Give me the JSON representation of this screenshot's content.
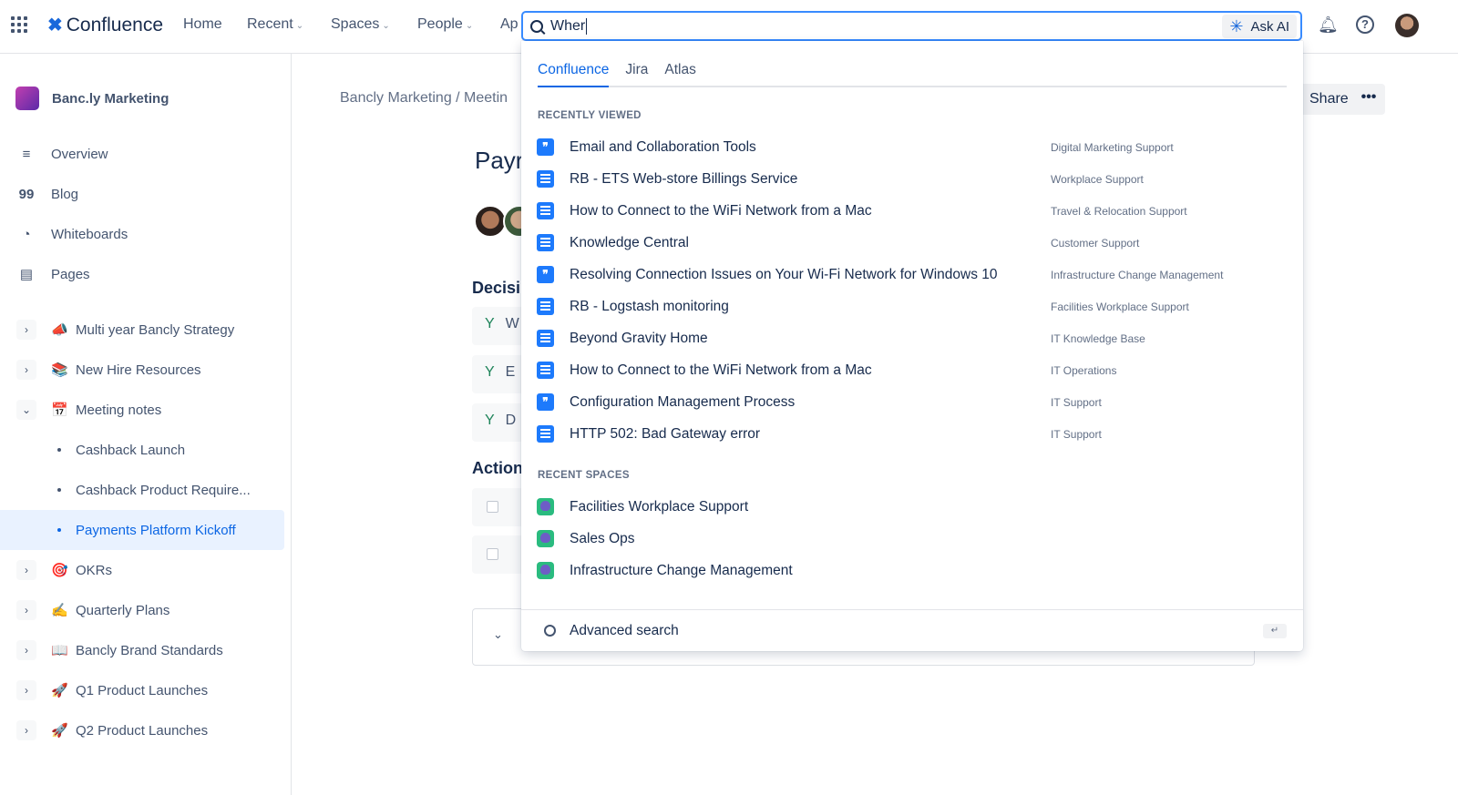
{
  "topbar": {
    "app_name": "Confluence",
    "nav": [
      "Home",
      "Recent",
      "Spaces",
      "People",
      "Ap"
    ],
    "search_value": "Wher",
    "ask_ai": "Ask AI"
  },
  "sidebar": {
    "space_name": "Banc.ly Marketing",
    "items": [
      {
        "label": "Overview",
        "icon": "≡"
      },
      {
        "label": "Blog",
        "icon": "99"
      },
      {
        "label": "Whiteboards",
        "icon": "◔"
      },
      {
        "label": "Pages",
        "icon": "▤"
      }
    ],
    "tree": [
      {
        "label": "Multi year Bancly Strategy",
        "emoji": "📣",
        "expand": "›"
      },
      {
        "label": "New Hire Resources",
        "emoji": "📚",
        "expand": "›"
      },
      {
        "label": "Meeting notes",
        "emoji": "📅",
        "expand": "⌄"
      },
      {
        "label": "Cashback Launch",
        "child": true
      },
      {
        "label": "Cashback Product Require...",
        "child": true
      },
      {
        "label": "Payments Platform Kickoff",
        "child": true,
        "selected": true
      },
      {
        "label": "OKRs",
        "emoji": "🎯",
        "expand": "›"
      },
      {
        "label": "Quarterly Plans",
        "emoji": "✍️",
        "expand": "›"
      },
      {
        "label": "Bancly Brand Standards",
        "emoji": "📖",
        "expand": "›"
      },
      {
        "label": "Q1 Product Launches",
        "emoji": "🚀",
        "expand": "›"
      },
      {
        "label": "Q2 Product Launches",
        "emoji": "🚀",
        "expand": "›"
      }
    ]
  },
  "main": {
    "breadcrumb": "Bancly Marketing  /  Meetin",
    "share": "Share",
    "more": "•••",
    "title": "Payr",
    "decisions_heading": "Decisi",
    "decisions": [
      "W",
      "E",
      "D"
    ],
    "actions_heading": "Action"
  },
  "search_dropdown": {
    "tabs": [
      "Confluence",
      "Jira",
      "Atlas"
    ],
    "recently_viewed_label": "RECENTLY VIEWED",
    "recent": [
      {
        "title": "Email and Collaboration Tools",
        "space": "Digital Marketing Support",
        "type": "blog"
      },
      {
        "title": "RB - ETS Web-store Billings Service",
        "space": "Workplace Support",
        "type": "page"
      },
      {
        "title": "How to Connect to the WiFi Network from a Mac",
        "space": "Travel & Relocation Support",
        "type": "page"
      },
      {
        "title": "Knowledge Central",
        "space": "Customer Support",
        "type": "page"
      },
      {
        "title": "Resolving Connection Issues on Your Wi-Fi Network for Windows 10",
        "space": "Infrastructure Change Management",
        "type": "blog"
      },
      {
        "title": "RB - Logstash monitoring",
        "space": "Facilities Workplace Support",
        "type": "page"
      },
      {
        "title": "Beyond Gravity Home",
        "space": "IT Knowledge Base",
        "type": "page"
      },
      {
        "title": "How to Connect to the WiFi Network from a Mac",
        "space": "IT Operations",
        "type": "page"
      },
      {
        "title": "Configuration Management Process",
        "space": "IT Support",
        "type": "blog"
      },
      {
        "title": "HTTP 502: Bad Gateway error",
        "space": "IT Support",
        "type": "page"
      }
    ],
    "recent_spaces_label": "RECENT SPACES",
    "spaces": [
      "Facilities Workplace Support",
      "Sales Ops",
      "Infrastructure Change Management"
    ],
    "advanced": "Advanced search",
    "enter_key": "↵"
  }
}
